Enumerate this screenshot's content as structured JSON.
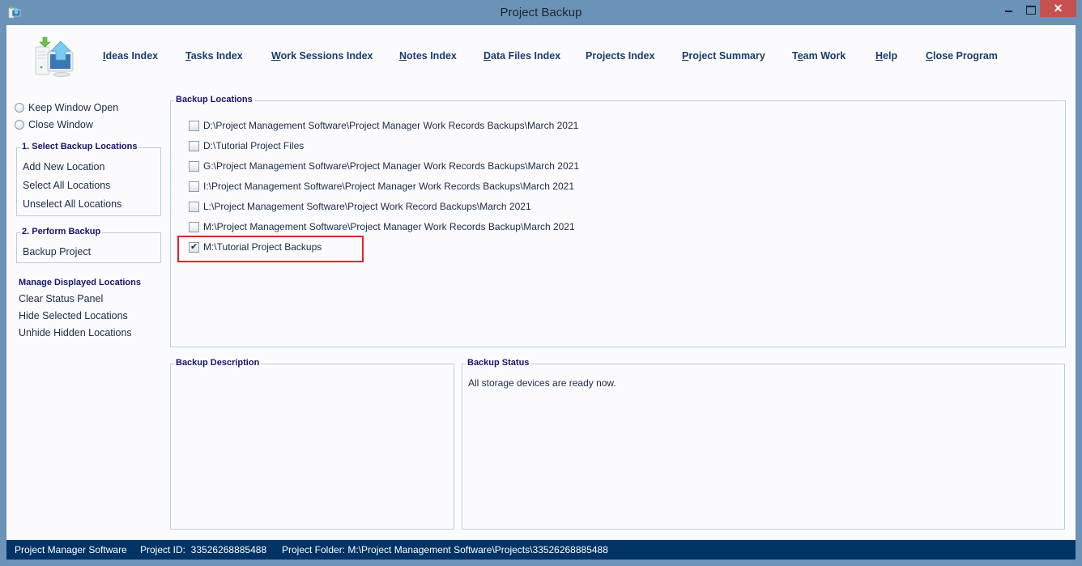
{
  "window": {
    "title": "Project Backup",
    "controls": {
      "minimize": "minimize",
      "maximize": "maximize",
      "close": "✕"
    }
  },
  "topnav": [
    {
      "label": "Ideas Index",
      "accesskey": "I"
    },
    {
      "label": "Tasks Index",
      "accesskey": "T"
    },
    {
      "label": "Work Sessions Index",
      "accesskey": "W"
    },
    {
      "label": "Notes Index",
      "accesskey": "N"
    },
    {
      "label": "Data Files Index",
      "accesskey": "D"
    },
    {
      "label": "Projects Index",
      "accesskey": ""
    },
    {
      "label": "Project Summary",
      "accesskey": "P"
    },
    {
      "label": "Team Work",
      "accesskey": "e"
    },
    {
      "label": "Help",
      "accesskey": "H"
    },
    {
      "label": "Close Program",
      "accesskey": "C"
    }
  ],
  "sidebar": {
    "window_options": [
      {
        "label": "Keep Window Open",
        "selected": false
      },
      {
        "label": "Close Window",
        "selected": false
      }
    ],
    "select_group": {
      "title": "1. Select Backup Locations",
      "links": [
        "Add New Location",
        "Select All Locations",
        "Unselect All Locations"
      ]
    },
    "perform_group": {
      "title": "2. Perform Backup",
      "links": [
        "Backup Project"
      ]
    },
    "manage": {
      "title": "Manage Displayed Locations",
      "links": [
        "Clear Status Panel",
        "Hide Selected Locations",
        "Unhide Hidden Locations"
      ]
    }
  },
  "backup_locations": {
    "title": "Backup Locations",
    "items": [
      {
        "path": "D:\\Project Management Software\\Project Manager Work Records Backups\\March 2021",
        "checked": false
      },
      {
        "path": "D:\\Tutorial Project Files",
        "checked": false
      },
      {
        "path": "G:\\Project Management Software\\Project Manager Work Records Backups\\March 2021",
        "checked": false
      },
      {
        "path": "I:\\Project Management Software\\Project Manager Work Records Backups\\March 2021",
        "checked": false
      },
      {
        "path": "L:\\Project Management Software\\Project Work Record Backups\\March 2021",
        "checked": false
      },
      {
        "path": "M:\\Project Management Software\\Project Manager Work Records Backup\\March 2021",
        "checked": false
      },
      {
        "path": "M:\\Tutorial Project Backups",
        "checked": true
      }
    ]
  },
  "backup_description": {
    "title": "Backup Description",
    "text": ""
  },
  "backup_status": {
    "title": "Backup Status",
    "text": "All storage devices are ready now."
  },
  "statusbar": {
    "app_name": "Project Manager Software",
    "project_id": "Project ID:  33526268885488",
    "project_folder": "Project Folder: M:\\Project Management Software\\Projects\\33526268885488"
  },
  "colors": {
    "frame": "#6b93b8",
    "statusbar": "#003366",
    "highlight": "#e0202a",
    "group_title": "#17146b",
    "close_button": "#c75050"
  }
}
